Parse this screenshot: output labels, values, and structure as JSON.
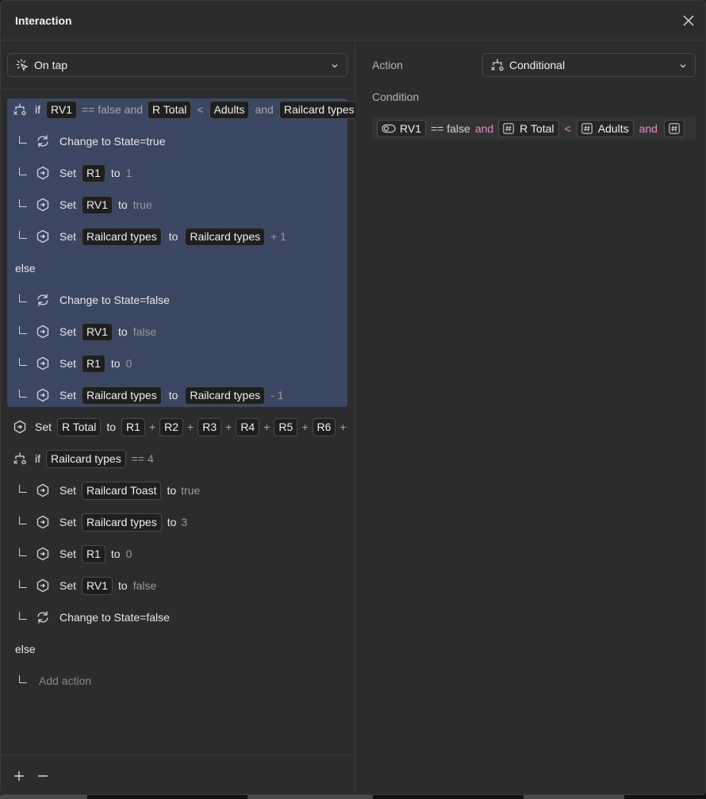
{
  "header": {
    "title": "Interaction"
  },
  "trigger": {
    "value": "On tap"
  },
  "rows": {
    "r1": {
      "kw": "if",
      "v1": "RV1",
      "op1": "== false and",
      "v2": "R Total",
      "op2": "<",
      "v3": "Adults",
      "op3": "and",
      "v4": "Railcard types"
    },
    "r2": {
      "text": "Change to State=true"
    },
    "r3": {
      "kw": "Set",
      "v1": "R1",
      "to": "to",
      "val": "1"
    },
    "r4": {
      "kw": "Set",
      "v1": "RV1",
      "to": "to",
      "val": "true"
    },
    "r5": {
      "kw": "Set",
      "v1": "Railcard types",
      "to": "to",
      "v2": "Railcard types",
      "val": "+ 1"
    },
    "r6": {
      "text": "else"
    },
    "r7": {
      "text": "Change to State=false"
    },
    "r8": {
      "kw": "Set",
      "v1": "RV1",
      "to": "to",
      "val": "false"
    },
    "r9": {
      "kw": "Set",
      "v1": "R1",
      "to": "to",
      "val": "0"
    },
    "r10": {
      "kw": "Set",
      "v1": "Railcard types",
      "to": "to",
      "v2": "Railcard types",
      "val": "- 1"
    },
    "r11": {
      "kw": "Set",
      "v1": "R Total",
      "to": "to",
      "a": "R1",
      "b": "R2",
      "c": "R3",
      "d": "R4",
      "e": "R5",
      "f": "R6",
      "plus": "+"
    },
    "r12": {
      "kw": "if",
      "v1": "Railcard types",
      "val": "== 4"
    },
    "r13": {
      "kw": "Set",
      "v1": "Railcard Toast",
      "to": "to",
      "val": "true"
    },
    "r14": {
      "kw": "Set",
      "v1": "Railcard types",
      "to": "to",
      "val": "3"
    },
    "r15": {
      "kw": "Set",
      "v1": "R1",
      "to": "to",
      "val": "0"
    },
    "r16": {
      "kw": "Set",
      "v1": "RV1",
      "to": "to",
      "val": "false"
    },
    "r17": {
      "text": "Change to State=false"
    },
    "r18": {
      "text": "else"
    },
    "r19": {
      "text": "Add action"
    }
  },
  "action": {
    "label": "Action",
    "value": "Conditional"
  },
  "condition": {
    "label": "Condition",
    "v1": "RV1",
    "op1": "== false",
    "and1": "and",
    "v2": "R Total",
    "op2": "<",
    "v3": "Adults",
    "and2": "and"
  },
  "icons": {
    "close": "close-icon",
    "tap": "tap-icon",
    "conditional": "conditional-icon",
    "refresh": "refresh-icon",
    "set": "set-variable-icon",
    "toggle": "toggle-icon",
    "number": "number-icon",
    "add": "plus-icon",
    "remove": "minus-icon"
  },
  "colors": {
    "highlight": "#3b4663",
    "pink": "#e58ad2",
    "panel": "#2c2c2c"
  }
}
